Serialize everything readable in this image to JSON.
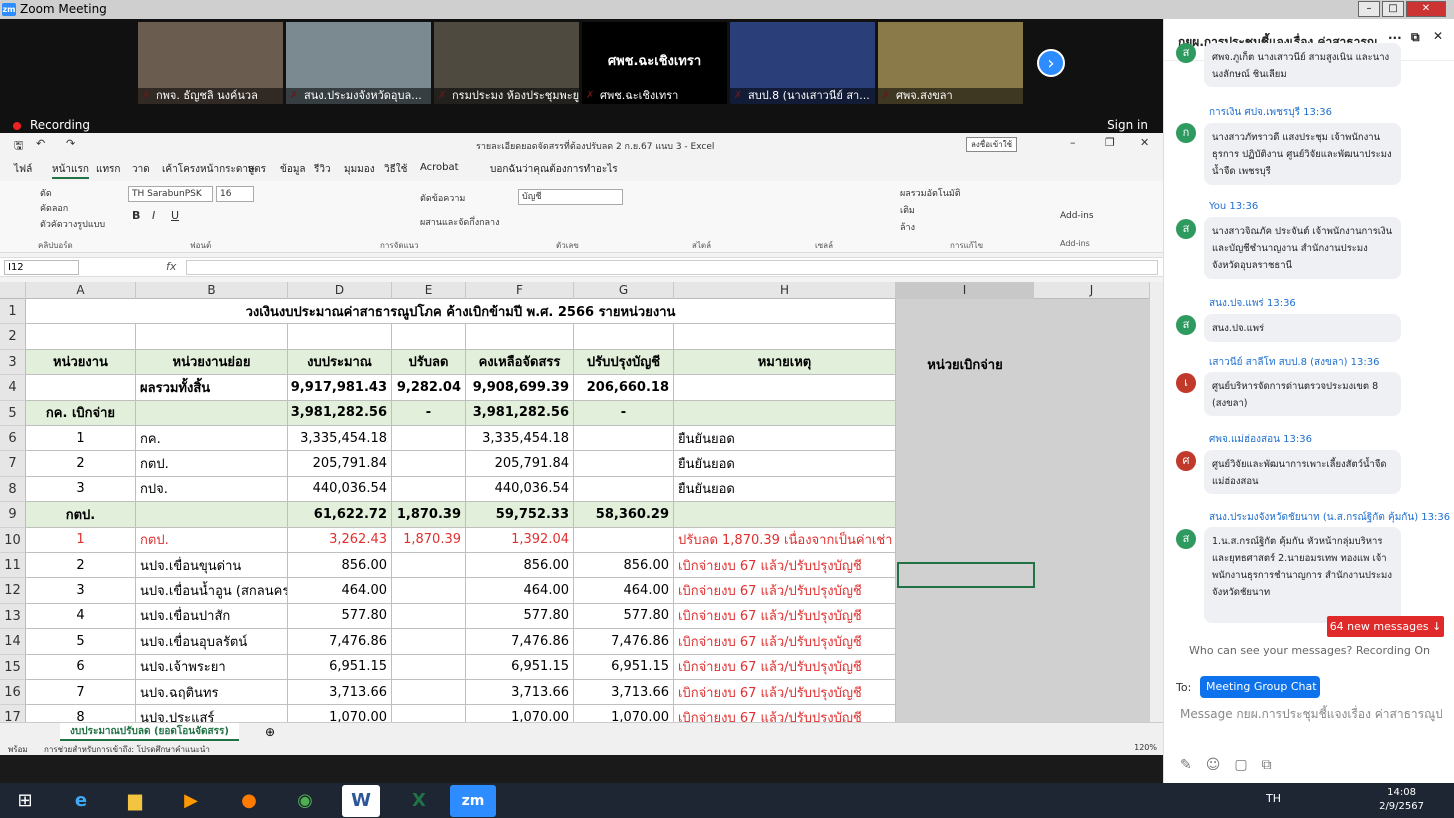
{
  "window": {
    "title": "Zoom Meeting"
  },
  "participants": [
    {
      "name": "กพจ. ธัญชลิ นงค์นวล",
      "bg": "#6b5c50"
    },
    {
      "name": "สนง.ประมงจังหวัดอุบล...",
      "bg": "#7a8a90"
    },
    {
      "name": "กรมประมง ห้องประชุมพะยูน",
      "bg": "#4f4a40"
    },
    {
      "name": "ศพช.ฉะเชิงเทรา",
      "bg": "#000000",
      "label": "ศพช.ฉะเชิงเทรา"
    },
    {
      "name": "สบป.8 (นางเสาวนีย์ สา...",
      "bg": "#2a3f7a"
    },
    {
      "name": "ศพจ.สงขลา",
      "bg": "#8a7a4a"
    }
  ],
  "recording": {
    "label": "Recording",
    "signin": "Sign in"
  },
  "excel": {
    "title": "รายละเอียดยอดจัดสรรที่ต้องปรับลด 2 ก.ย.67 แนบ 3  -  Excel",
    "login": "ลงชื่อเข้าใช้",
    "tabs": [
      "ไฟล์",
      "หน้าแรก",
      "แทรก",
      "วาด",
      "เค้าโครงหน้ากระดาษ",
      "สูตร",
      "ข้อมูล",
      "รีวิว",
      "มุมมอง",
      "วิธีใช้",
      "Acrobat",
      "บอกฉันว่าคุณต้องการทำอะไร"
    ],
    "ribbon": {
      "font": "TH SarabunPSK",
      "size": "16",
      "numfmt": "บัญชี",
      "groups": [
        "คลิปบอร์ด",
        "ฟอนต์",
        "การจัดแนว",
        "ตัวเลข",
        "สไตล์",
        "เซลล์",
        "การแก้ไข",
        "Add-ins"
      ],
      "cut": "ตัด",
      "copy": "คัดลอก",
      "painter": "ตัวคัดวางรูปแบบ",
      "wrap": "ตัดข้อความ",
      "merge": "ผสานและจัดกึ่งกลาง",
      "autosum": "ผลรวมอัตโนมัติ",
      "fill": "เติม",
      "clear": "ล้าง",
      "addins": "Add-ins"
    },
    "namebox": "I12",
    "columns": [
      "A",
      "B",
      "D",
      "E",
      "F",
      "G",
      "H",
      "I",
      "J"
    ],
    "sheet_tab": "งบประมาณปรับลด (ยอดโอนจัดสรร)",
    "status": "พร้อม",
    "access": "การช่วยสำหรับการเข้าถึง: โปรดศึกษาคำแนะนำ",
    "zoom": "120%",
    "col_i_header": "หน่วยเบิกจ่าย",
    "sheet_title": "วงเงินงบประมาณค่าสาธารณูปโภค ค้างเบิกข้ามปี พ.ศ. 2566 รายหน่วยงาน",
    "header": [
      "หน่วยงาน",
      "หน่วยงานย่อย",
      "งบประมาณ",
      "ปรับลด",
      "คงเหลือจัดสรร",
      "ปรับปรุงบัญชี",
      "หมายเหตุ"
    ],
    "rows": [
      {
        "n": "4",
        "a": "",
        "b": "ผลรวมทั้งสิ้น",
        "d": "9,917,981.43",
        "e": "9,282.04",
        "f": "9,908,699.39",
        "g": "206,660.18",
        "h": "",
        "style": "bold"
      },
      {
        "n": "5",
        "a": "กค. เบิกจ่าย",
        "b": "",
        "d": "3,981,282.56",
        "e": "-",
        "f": "3,981,282.56",
        "g": "-",
        "h": "",
        "style": "green"
      },
      {
        "n": "6",
        "a": "1",
        "b": "กค.",
        "d": "3,335,454.18",
        "e": "",
        "f": "3,335,454.18",
        "g": "",
        "h": "ยืนยันยอด",
        "style": ""
      },
      {
        "n": "7",
        "a": "2",
        "b": "กตป.",
        "d": "205,791.84",
        "e": "",
        "f": "205,791.84",
        "g": "",
        "h": "ยืนยันยอด",
        "style": ""
      },
      {
        "n": "8",
        "a": "3",
        "b": "กปจ.",
        "d": "440,036.54",
        "e": "",
        "f": "440,036.54",
        "g": "",
        "h": "ยืนยันยอด",
        "style": ""
      },
      {
        "n": "9",
        "a": "กตป.",
        "b": "",
        "d": "61,622.72",
        "e": "1,870.39",
        "f": "59,752.33",
        "g": "58,360.29",
        "h": "",
        "style": "green"
      },
      {
        "n": "10",
        "a": "1",
        "b": "กตป.",
        "d": "3,262.43",
        "e": "1,870.39",
        "f": "1,392.04",
        "g": "",
        "h": "ปรับลด 1,870.39 เนื่องจากเป็นค่าเช่า",
        "style": "red"
      },
      {
        "n": "11",
        "a": "2",
        "b": "นปจ.เขื่อนขุนด่าน",
        "d": "856.00",
        "e": "",
        "f": "856.00",
        "g": "856.00",
        "h": "เบิกจ่ายงบ 67 แล้ว/ปรับปรุงบัญชี",
        "style": "hred"
      },
      {
        "n": "12",
        "a": "3",
        "b": "นปจ.เขื่อนน้ำอูน (สกลนคร)",
        "d": "464.00",
        "e": "",
        "f": "464.00",
        "g": "464.00",
        "h": "เบิกจ่ายงบ 67 แล้ว/ปรับปรุงบัญชี",
        "style": "hred"
      },
      {
        "n": "13",
        "a": "4",
        "b": "นปจ.เขื่อนปาสัก",
        "d": "577.80",
        "e": "",
        "f": "577.80",
        "g": "577.80",
        "h": "เบิกจ่ายงบ 67 แล้ว/ปรับปรุงบัญชี",
        "style": "hred"
      },
      {
        "n": "14",
        "a": "5",
        "b": "นปจ.เขื่อนอุบลรัตน์",
        "d": "7,476.86",
        "e": "",
        "f": "7,476.86",
        "g": "7,476.86",
        "h": "เบิกจ่ายงบ 67 แล้ว/ปรับปรุงบัญชี",
        "style": "hred"
      },
      {
        "n": "15",
        "a": "6",
        "b": "นปจ.เจ้าพระยา",
        "d": "6,951.15",
        "e": "",
        "f": "6,951.15",
        "g": "6,951.15",
        "h": "เบิกจ่ายงบ 67 แล้ว/ปรับปรุงบัญชี",
        "style": "hred"
      },
      {
        "n": "16",
        "a": "7",
        "b": "นปจ.ฉฤตินทร",
        "d": "3,713.66",
        "e": "",
        "f": "3,713.66",
        "g": "3,713.66",
        "h": "เบิกจ่ายงบ 67 แล้ว/ปรับปรุงบัญชี",
        "style": "hred"
      },
      {
        "n": "17",
        "a": "8",
        "b": "นปจ.ประแสร์",
        "d": "1,070.00",
        "e": "",
        "f": "1,070.00",
        "g": "1,070.00",
        "h": "เบิกจ่ายงบ 67 แล้ว/ปรับปรุงบัญชี",
        "style": "hred"
      }
    ]
  },
  "chat": {
    "title": "กยผ.การประชุมชี้แจงเรื่อง ค่าสาธารณู...",
    "messages": [
      {
        "sender": "",
        "text": "ศพจ.ภูเก็ต นางเสาวนีย์ สามสูงเนิน และนาง นงลักษณ์ ชินเลียม",
        "avatar": "ส",
        "color": "#2e9a5f"
      },
      {
        "sender": "การเงิน ศปจ.เพชรบุรี 13:36",
        "text": "นางสาวภัทราวดี แสงประชุม เจ้าพนักงานธุรการ ปฏิบัติงาน ศูนย์วิจัยและพัฒนาประมงน้ำจืด เพชรบุรี",
        "avatar": "ก",
        "color": "#2e9a5f"
      },
      {
        "sender": "You 13:36",
        "text": "นางสาวจิณภัค ประจันต์ เจ้าพนักงานการเงินและบัญชีชำนาญงาน สำนักงานประมงจังหวัดอุบลราชธานี",
        "avatar": "ส",
        "color": "#2e9a5f"
      },
      {
        "sender": "สนง.ปจ.แพร่ 13:36",
        "text": "สนง.ปจ.แพร่",
        "avatar": "ส",
        "color": "#2e9a5f"
      },
      {
        "sender": "เสาวนีย์ สาลีโท สบป.8 (สงขลา) 13:36",
        "text": "ศูนย์บริหารจัดการด่านตรวจประมงเขต 8 (สงขลา)",
        "avatar": "เ",
        "color": "#c0392b"
      },
      {
        "sender": "ศพจ.แม่ฮ่องสอน 13:36",
        "text": "ศูนย์วิจัยและพัฒนาการเพาะเลี้ยงสัตว์น้ำจืดแม่ฮ่องสอน",
        "avatar": "ศ",
        "color": "#c0392b"
      },
      {
        "sender": "สนง.ประมงจังหวัดชัยนาท (น.ส.กรณ์ฐิกัต คุ้มกัน) 13:36",
        "text": "1.น.ส.กรณ์ฐิกัต คุ้มกัน หัวหน้ากลุ่มบริหารและยุทธศาสตร์ 2.นายอมรเทพ ทองแพ เจ้าพนักงานธุรการชำนาญการ สำนักงานประมงจังหวัดชัยนาท",
        "avatar": "ส",
        "color": "#2e9a5f"
      }
    ],
    "new_messages": "64 new messages ↓",
    "who_can_see": "Who can see your messages? Recording On",
    "to_label": "To:",
    "to_value": "Meeting Group Chat ⌄",
    "input_placeholder": "Message กยผ.การประชุมชี้แจงเรื่อง ค่าสาธารณูป..."
  },
  "taskbar": {
    "lang": "TH",
    "time": "14:08",
    "date": "2/9/2567",
    "apps": [
      "windows-start",
      "internet-explorer",
      "file-explorer",
      "media-player",
      "firefox",
      "chrome",
      "word",
      "excel",
      "zoom"
    ]
  }
}
